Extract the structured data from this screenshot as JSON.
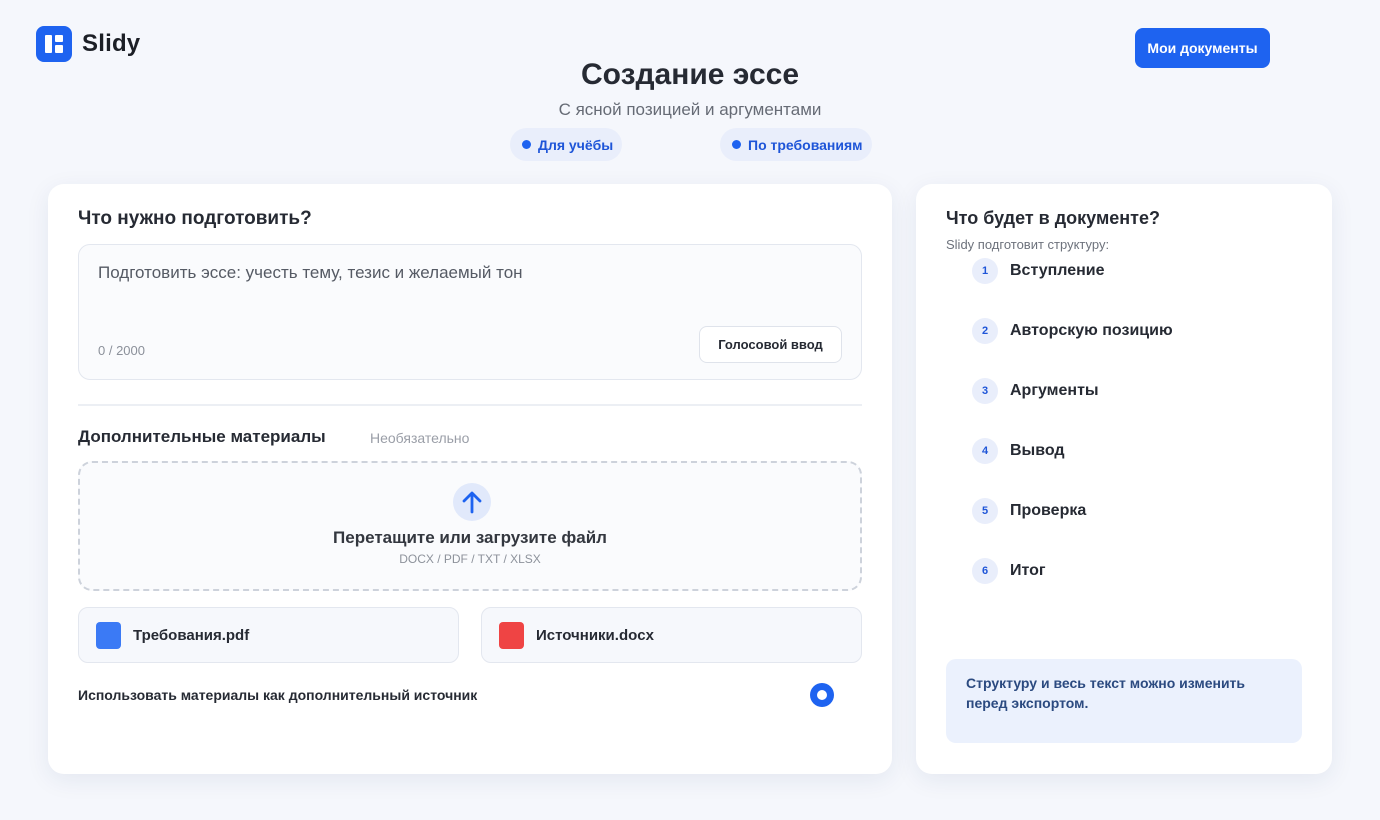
{
  "brand": {
    "name": "Slidy",
    "accent": "#1e63f0"
  },
  "header": {
    "my_docs_label": "Мои документы",
    "title": "Создание эссе",
    "subtitle": "С ясной позицией и аргументами",
    "pills": [
      "Для учёбы",
      "По требованиям"
    ]
  },
  "main": {
    "task_title": "Что нужно подготовить?",
    "prompt_placeholder": "Подготовить эссе: учесть тему, тезис и желаемый тон",
    "counter": "0 / 2000",
    "voice_label": "Голосовой ввод",
    "materials_title": "Дополнительные материалы",
    "optional_label": "Необязательно",
    "upload": {
      "icon": "arrow-up-icon",
      "title": "Перетащите или загрузите файл",
      "formats": "DOCX / PDF / TXT / XLSX"
    },
    "files": [
      {
        "name": "Требования.pdf",
        "color": "#3b7af5"
      },
      {
        "name": "Источники.docx",
        "color": "#ef4444"
      }
    ],
    "use_materials_label": "Использовать материалы как дополнительный источник",
    "use_materials_checked": true
  },
  "side": {
    "title": "Что будет в документе?",
    "subtitle": "Slidy подготовит структуру:",
    "items": [
      {
        "num": "1",
        "label": "Вступление"
      },
      {
        "num": "2",
        "label": "Авторскую позицию"
      },
      {
        "num": "3",
        "label": "Аргументы"
      },
      {
        "num": "4",
        "label": "Вывод"
      },
      {
        "num": "5",
        "label": "Проверка"
      },
      {
        "num": "6",
        "label": "Итог"
      }
    ],
    "note": "Структуру и весь текст можно изменить перед экспортом."
  }
}
